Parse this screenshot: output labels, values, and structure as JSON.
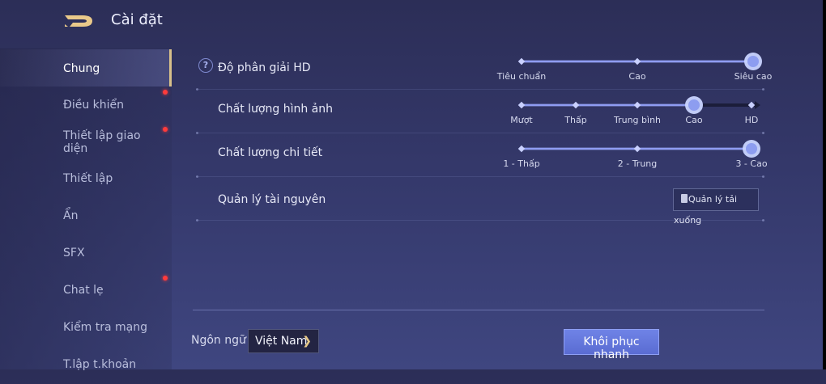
{
  "header": {
    "title": "Cài đặt",
    "logo_icon": "back-d-logo-icon"
  },
  "colors": {
    "accent_gold": "#d8c08a",
    "slider_track": "#7f8ef0",
    "notify_dot": "#ff3b3b",
    "button_blue": "#5a6cd2"
  },
  "sidebar": {
    "items": [
      {
        "label": "Chung",
        "active": true,
        "dot": false
      },
      {
        "label": "Điều khiển",
        "active": false,
        "dot": true
      },
      {
        "label": "Thiết lập giao diện",
        "active": false,
        "dot": true
      },
      {
        "label": "Thiết lập",
        "active": false,
        "dot": false
      },
      {
        "label": "Ẩn",
        "active": false,
        "dot": false
      },
      {
        "label": "SFX",
        "active": false,
        "dot": false
      },
      {
        "label": "Chat lẹ",
        "active": false,
        "dot": true
      },
      {
        "label": "Kiểm tra mạng",
        "active": false,
        "dot": false
      },
      {
        "label": "T.lập t.khoản",
        "active": false,
        "dot": false
      }
    ]
  },
  "settings": {
    "hd_resolution": {
      "label": "Độ phân giải HD",
      "help_icon": "?",
      "options": [
        "Tiêu chuẩn",
        "Cao",
        "Siêu cao"
      ],
      "selected_index": 2
    },
    "image_quality": {
      "label": "Chất lượng hình ảnh",
      "options": [
        "Mượt",
        "Thấp",
        "Trung bình",
        "Cao",
        "HD"
      ],
      "selected_index": 3
    },
    "detail_quality": {
      "label": "Chất lượng chi tiết",
      "options": [
        "1 - Thấp",
        "2 - Trung",
        "3 - Cao"
      ],
      "selected_index": 2
    },
    "resources": {
      "label": "Quản lý tài nguyên",
      "button_label": "Quản lý tải xuống"
    }
  },
  "footer": {
    "language_label": "Ngôn ngữ",
    "language_value": "Việt Nam",
    "language_chevron": "❯",
    "restore_button": "Khôi phục nhanh"
  }
}
